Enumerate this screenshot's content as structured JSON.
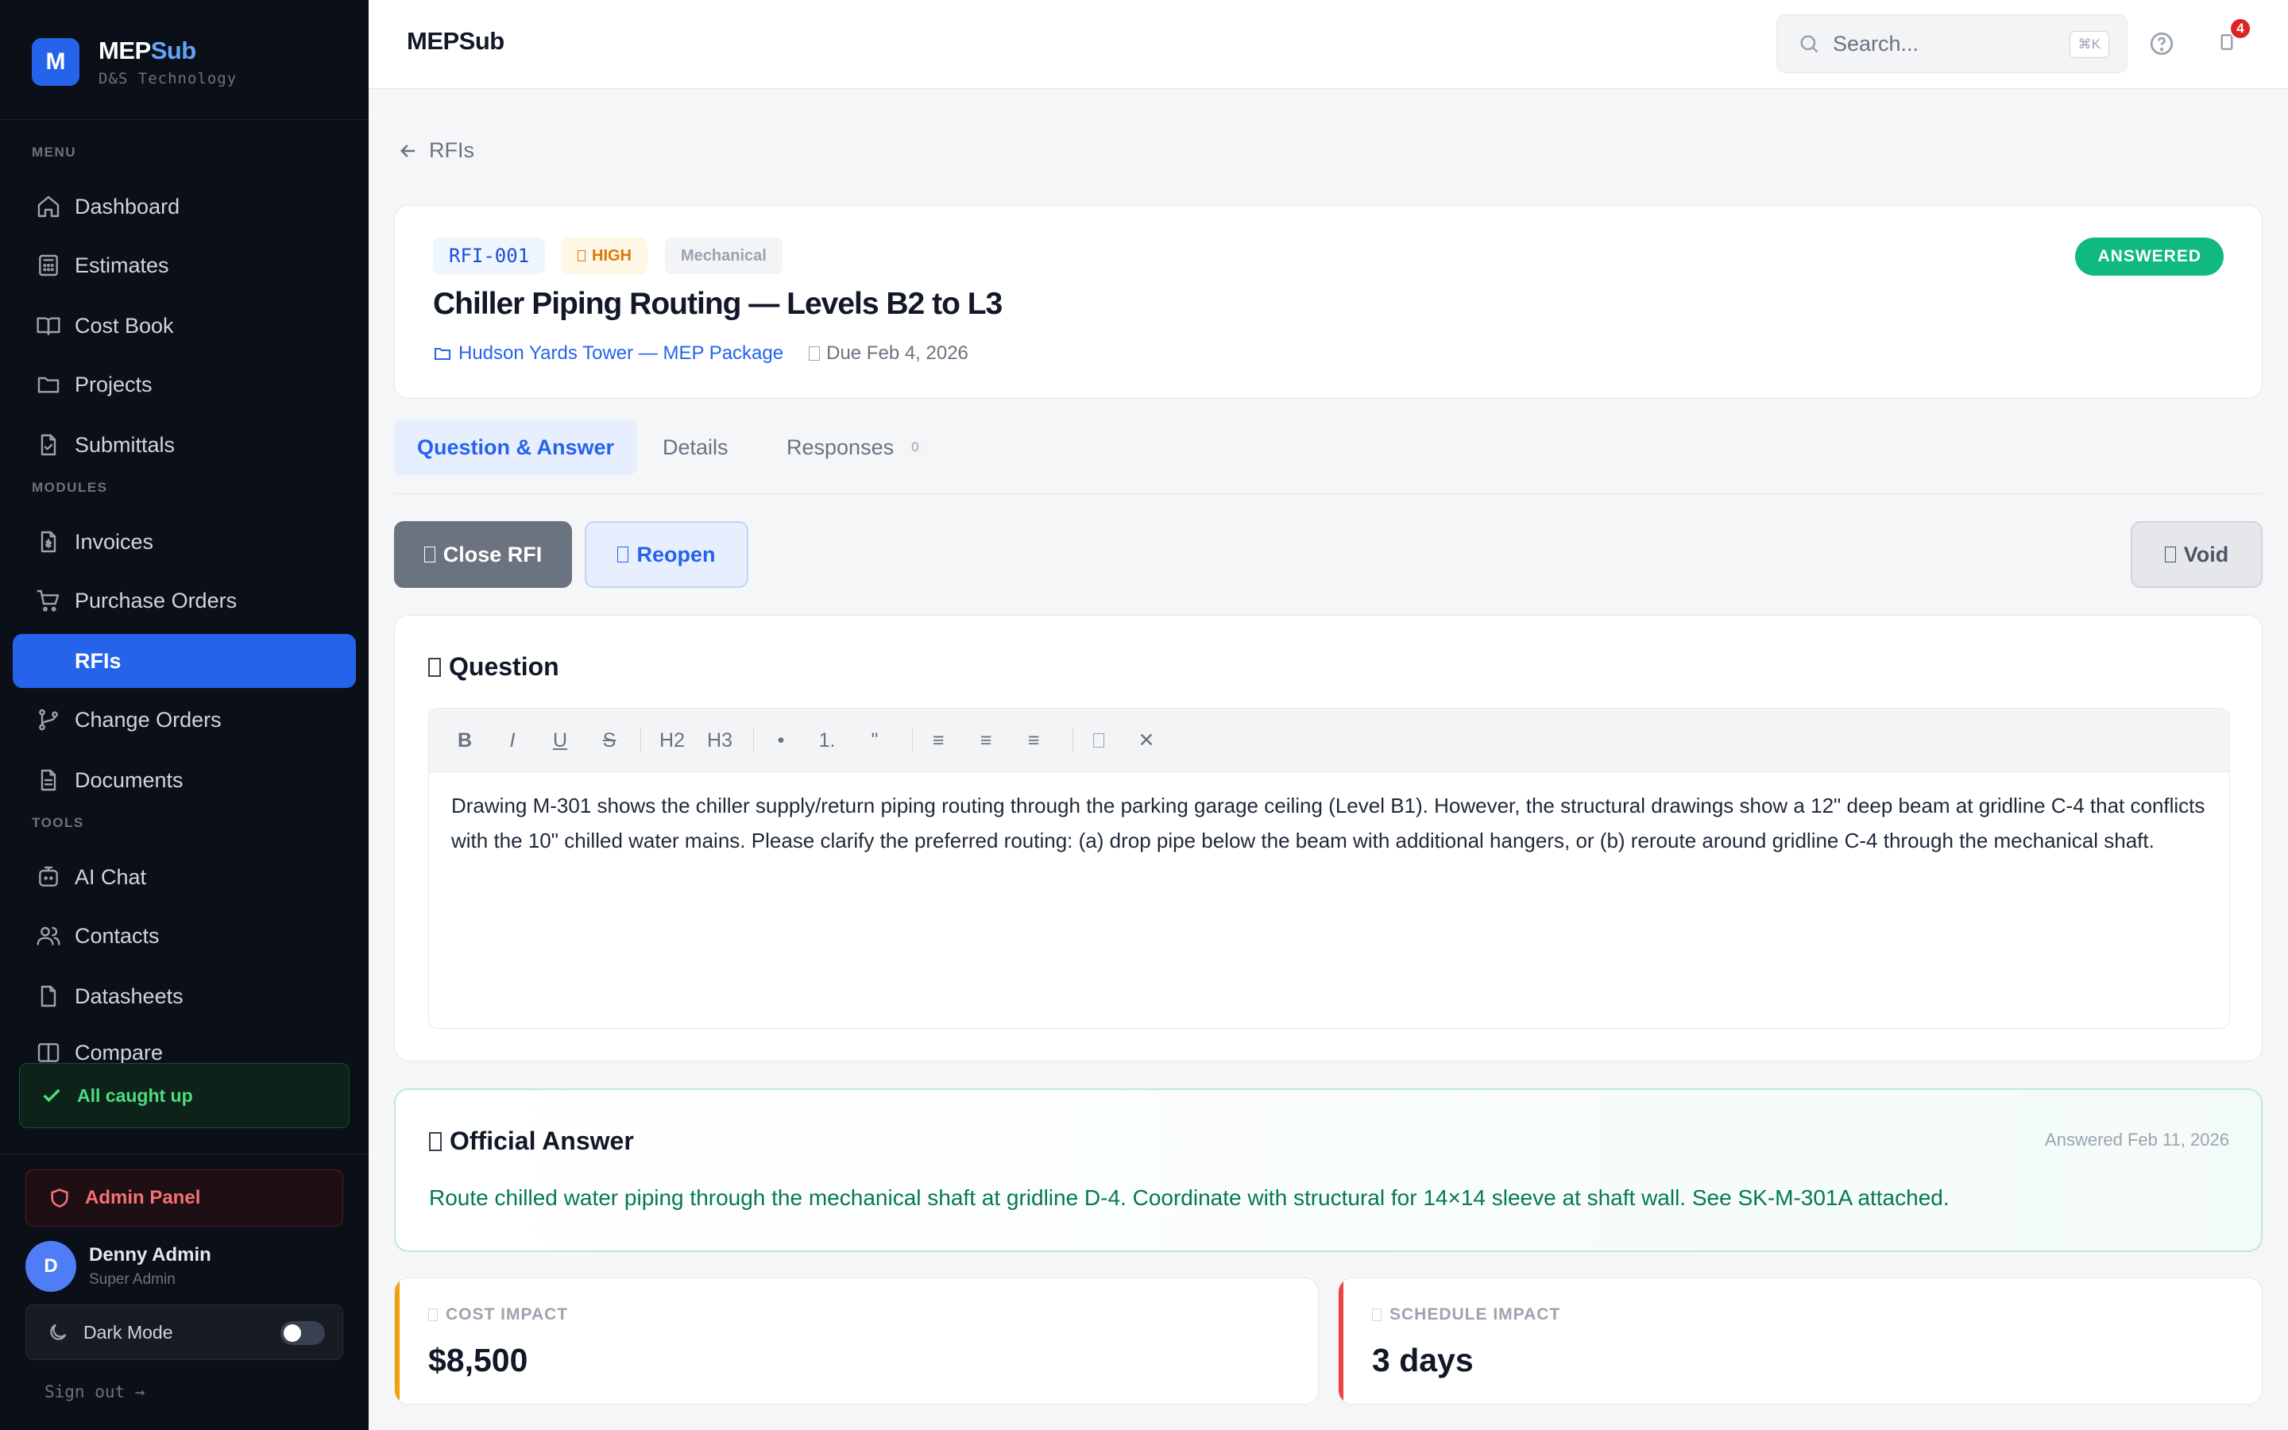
{
  "brand": {
    "name_main": "MEP",
    "name_accent": "Sub",
    "logo_letter": "M",
    "org": "D&S Technology"
  },
  "sidebar": {
    "sections": {
      "menu": "MENU",
      "modules": "MODULES",
      "tools": "TOOLS"
    },
    "menu_items": [
      {
        "label": "Dashboard",
        "icon": "home-icon"
      },
      {
        "label": "Estimates",
        "icon": "calculator-icon"
      },
      {
        "label": "Cost Book",
        "icon": "book-icon"
      },
      {
        "label": "Projects",
        "icon": "folder-icon"
      },
      {
        "label": "Submittals",
        "icon": "file-check-icon"
      }
    ],
    "module_items": [
      {
        "label": "Invoices",
        "icon": "invoice-icon"
      },
      {
        "label": "Purchase Orders",
        "icon": "cart-icon"
      },
      {
        "label": "RFIs",
        "icon": "rfi-icon",
        "active": true
      },
      {
        "label": "Change Orders",
        "icon": "git-branch-icon"
      },
      {
        "label": "Documents",
        "icon": "document-icon"
      }
    ],
    "tool_items": [
      {
        "label": "AI Chat",
        "icon": "bot-icon"
      },
      {
        "label": "Contacts",
        "icon": "users-icon"
      },
      {
        "label": "Datasheets",
        "icon": "datasheet-icon"
      },
      {
        "label": "Compare",
        "icon": "compare-icon"
      }
    ],
    "caught_up": "All caught up",
    "admin_panel": "Admin Panel",
    "user": {
      "initial": "D",
      "name": "Denny Admin",
      "role": "Super Admin"
    },
    "dark_mode": {
      "label": "Dark Mode",
      "enabled": false
    },
    "sign_out": "Sign out →"
  },
  "topbar": {
    "title": "MEPSub",
    "search_placeholder": "Search...",
    "search_shortcut": "⌘K",
    "notification_count": "4"
  },
  "breadcrumb": {
    "back_label": "RFIs"
  },
  "rfi": {
    "id": "RFI-001",
    "priority": "HIGH",
    "trade": "Mechanical",
    "status": "ANSWERED",
    "title": "Chiller Piping Routing — Levels B2 to L3",
    "project": "Hudson Yards Tower — MEP Package",
    "due": "Due Feb 4, 2026"
  },
  "tabs": [
    {
      "label": "Question & Answer",
      "active": true
    },
    {
      "label": "Details"
    },
    {
      "label": "Responses",
      "count": "0"
    }
  ],
  "actions": {
    "close": "Close RFI",
    "reopen": "Reopen",
    "void": "Void"
  },
  "question": {
    "heading": "Question",
    "toolbar": [
      "B",
      "I",
      "U",
      "S",
      "H2",
      "H3",
      "•",
      "1.",
      "\"",
      "≡",
      "≡",
      "≡",
      "✕"
    ],
    "body": "Drawing M-301 shows the chiller supply/return piping routing through the parking garage ceiling (Level B1). However, the structural drawings show a 12\" deep beam at gridline C-4 that conflicts with the 10\" chilled water mains. Please clarify the preferred routing: (a) drop pipe below the beam with additional hangers, or (b) reroute around gridline C-4 through the mechanical shaft."
  },
  "answer": {
    "heading": "Official Answer",
    "answered_on": "Answered Feb 11, 2026",
    "body": "Route chilled water piping through the mechanical shaft at gridline D-4. Coordinate with structural for 14×14 sleeve at shaft wall. See SK-M-301A attached."
  },
  "impact": {
    "cost_label": "COST IMPACT",
    "cost_value": "$8,500",
    "schedule_label": "SCHEDULE IMPACT",
    "schedule_value": "3 days"
  },
  "colors": {
    "accent": "#2563eb",
    "success": "#10b981",
    "warning": "#f59e0b",
    "danger": "#ef4444",
    "sidebar_bg": "#0b0f17"
  }
}
